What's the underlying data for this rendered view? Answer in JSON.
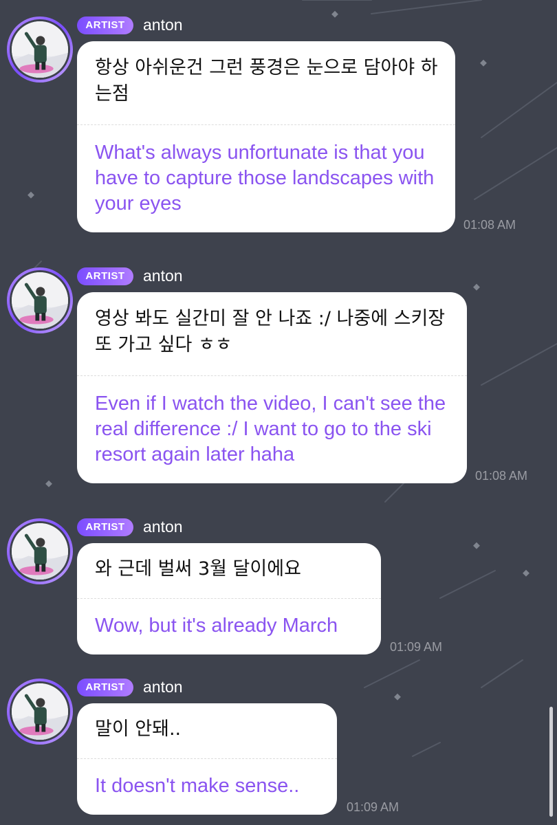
{
  "theme": {
    "background": "#3e424d",
    "bubble": "#ffffff",
    "translation_color": "#8a54f0",
    "badge_gradient": [
      "#7b4dff",
      "#b07cff"
    ],
    "timestamp_color": "#9a9ca3"
  },
  "messages": [
    {
      "badge": "ARTIST",
      "sender": "anton",
      "avatar_icon": "user-avatar-icon",
      "korean": "항상 아쉬운건 그런 풍경은 눈으로 담아야 하는점",
      "english": "What's always unfortunate is that you have to capture those landscapes with your eyes",
      "time": "01:08 AM"
    },
    {
      "badge": "ARTIST",
      "sender": "anton",
      "avatar_icon": "user-avatar-icon",
      "korean": "영상 봐도 실간미 잘 안 나죠 :/ 나중에 스키장 또 가고 싶다 ㅎㅎ",
      "english": "Even if I watch the video, I can't see the real difference :/ I want to go to the ski resort again later haha",
      "time": "01:08 AM"
    },
    {
      "badge": "ARTIST",
      "sender": "anton",
      "avatar_icon": "user-avatar-icon",
      "korean": "와 근데 벌써 3월 달이에요",
      "english": "Wow, but it's already March",
      "time": "01:09 AM"
    },
    {
      "badge": "ARTIST",
      "sender": "anton",
      "avatar_icon": "user-avatar-icon",
      "korean": "말이 안돼..",
      "english": "It doesn't make sense..",
      "time": "01:09 AM"
    }
  ]
}
